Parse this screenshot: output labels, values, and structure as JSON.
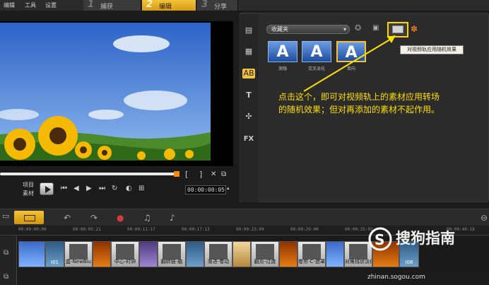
{
  "menu": [
    "编辑",
    "工具",
    "设置"
  ],
  "steps": [
    {
      "num": "1",
      "label": "捕获"
    },
    {
      "num": "2",
      "label": "编辑"
    },
    {
      "num": "3",
      "label": "分享"
    }
  ],
  "player": {
    "mode_project": "项目",
    "mode_clip": "素材",
    "mark_in": "[",
    "mark_out": "]",
    "timecode": "00:00:00:05"
  },
  "library": {
    "folder": "收藏夹",
    "thumbnails": [
      {
        "glyph": "A",
        "label": "渐隐"
      },
      {
        "glyph": "A",
        "label": "交叉淡化"
      },
      {
        "glyph": "A",
        "label": "单向"
      }
    ],
    "tooltip": "对视频轨应用随机效果",
    "annotation": "点击这个，即可对视频轨上的素材应用转场的随机效果；但对再添加的素材不起作用。"
  },
  "ruler_ticks": [
    "00:00:00:00",
    "00:00:05:21",
    "00:00:11:17",
    "00:00:17:13",
    "00:00:23:09",
    "00:00:29:00",
    "00:00:35:02",
    "00:00:40:18"
  ],
  "clips": [
    {
      "kind": "vid2",
      "label": ""
    },
    {
      "kind": "vid4",
      "label": "I01"
    },
    {
      "kind": "trans",
      "label": "盒-NewBlu"
    },
    {
      "kind": "vid1",
      "label": ""
    },
    {
      "kind": "trans",
      "label": "中心-时钟"
    },
    {
      "kind": "vid3",
      "label": ""
    },
    {
      "kind": "trans",
      "label": "翻转链-脑"
    },
    {
      "kind": "vid4",
      "label": ""
    },
    {
      "kind": "trans",
      "label": "渐进-卷动"
    },
    {
      "kind": "vid5",
      "label": ""
    },
    {
      "kind": "trans",
      "label": "翻页-过渡"
    },
    {
      "kind": "vid1",
      "label": ""
    },
    {
      "kind": "trans",
      "label": "卷帘-C-遮罩"
    },
    {
      "kind": "vid2",
      "label": ""
    },
    {
      "kind": "trans",
      "label": "对角线状淡化"
    },
    {
      "kind": "vid1",
      "label": ""
    },
    {
      "kind": "vid4",
      "label": "I08"
    }
  ],
  "watermark": {
    "brand": "搜狗指南",
    "url": "zhinan.sogou.com"
  }
}
